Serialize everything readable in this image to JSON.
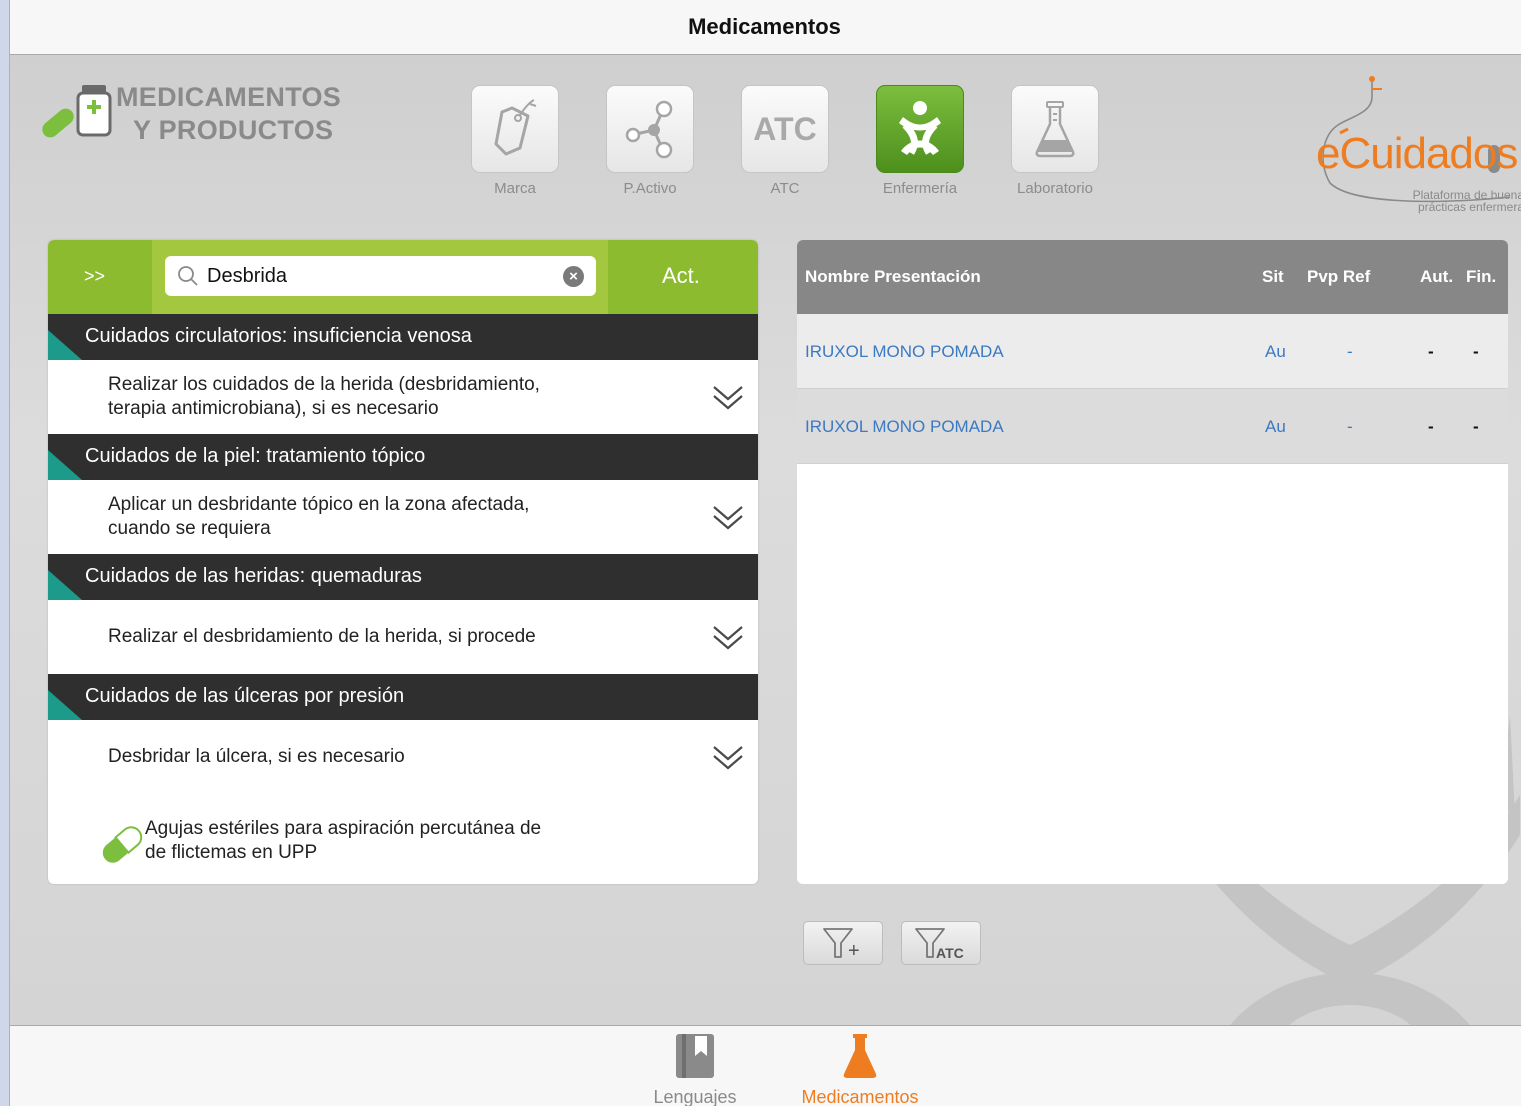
{
  "navbar": {
    "title": "Medicamentos"
  },
  "brand": {
    "line1": "MEDICAMENTOS",
    "line2": "Y PRODUCTOS"
  },
  "categories": [
    {
      "label": "Marca",
      "icon": "tag-icon"
    },
    {
      "label": "P.Activo",
      "icon": "molecule-icon"
    },
    {
      "label": "ATC",
      "icon": "atc-text-icon",
      "icon_text": "ATC"
    },
    {
      "label": "Enfermería",
      "icon": "nursing-icon",
      "active": true
    },
    {
      "label": "Laboratorio",
      "icon": "flask-icon"
    }
  ],
  "logo": {
    "text": "eCuidados",
    "sub1": "Plataforma de buenas",
    "sub2": "prácticas enfermeras"
  },
  "search": {
    "expand_label": ">>",
    "value": "Desbrida",
    "placeholder": "",
    "action_label": "Act."
  },
  "sections": [
    {
      "title": "Cuidados circulatorios: insuficiencia venosa",
      "item": {
        "line1": "Realizar los cuidados de la herida (desbridamiento,",
        "line2": "terapia antimicrobiana), si es necesario"
      }
    },
    {
      "title": "Cuidados de la piel: tratamiento tópico",
      "item": {
        "line1": "Aplicar un desbridante tópico en la zona afectada,",
        "line2": "cuando se requiera"
      }
    },
    {
      "title": "Cuidados de las heridas: quemaduras",
      "item": {
        "line1": "Realizar el desbridamiento de la herida, si procede",
        "line2": ""
      }
    },
    {
      "title": "Cuidados de las úlceras por presión",
      "item": {
        "line1": "Desbridar la úlcera, si es necesario",
        "line2": ""
      }
    }
  ],
  "product": {
    "line1": "Agujas estériles para aspiración percutánea de",
    "line2": "de flictemas en UPP"
  },
  "table": {
    "headers": {
      "name": "Nombre Presentación",
      "sit": "Sit",
      "pvp": "Pvp Ref",
      "aut": "Aut.",
      "fin": "Fin."
    },
    "rows": [
      {
        "name": "IRUXOL MONO POMADA",
        "sit": "Au",
        "pvp": "-",
        "aut": "-",
        "fin": "-"
      },
      {
        "name": "IRUXOL MONO POMADA",
        "sit": "Au",
        "pvp": "-",
        "aut": "-",
        "fin": "-"
      }
    ]
  },
  "filters": [
    {
      "icon": "filter-add-icon",
      "text": "+"
    },
    {
      "icon": "filter-atc-icon",
      "text": "ATC"
    }
  ],
  "tabs": [
    {
      "label": "Lenguajes",
      "color": "#8a8a8a",
      "icon": "book-icon"
    },
    {
      "label": "Medicamentos",
      "color": "#ee7d22",
      "icon": "flask-icon",
      "active": true
    }
  ],
  "colors": {
    "accent_green": "#8dbb2f",
    "accent_orange": "#ee7d22",
    "link_blue": "#3b79c2",
    "teal": "#1c9a8a"
  }
}
